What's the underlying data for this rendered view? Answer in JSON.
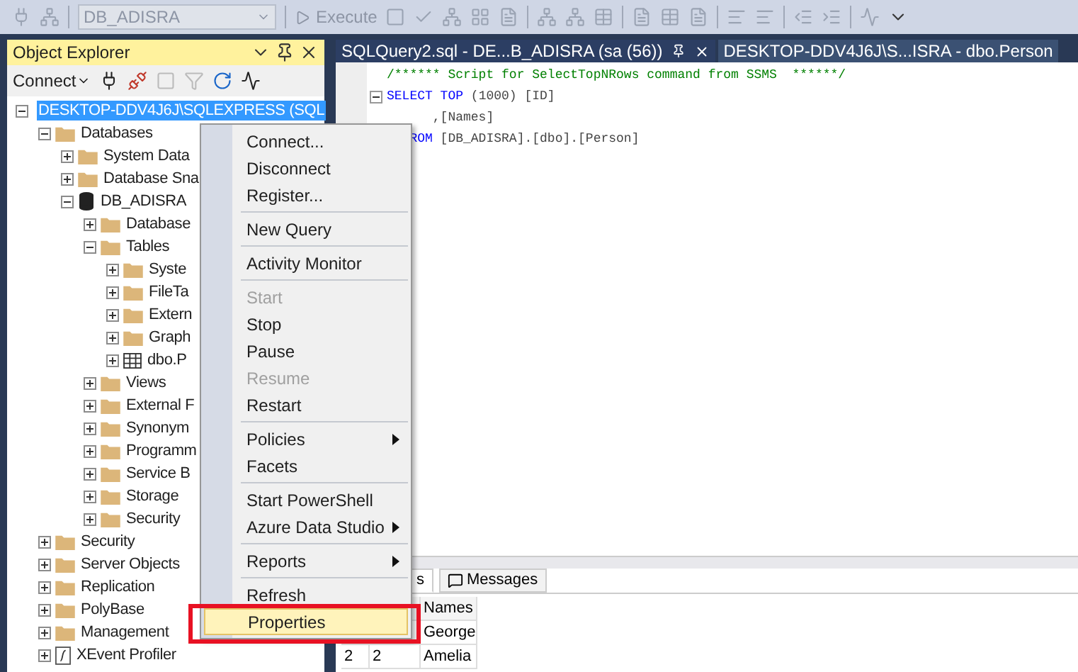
{
  "toolbar": {
    "database": "DB_ADISRA",
    "execute_label": "Execute"
  },
  "object_explorer": {
    "title": "Object Explorer",
    "connect_label": "Connect",
    "tree": [
      {
        "label": "DESKTOP-DDV4J6J\\SQLEXPRESS (SQL",
        "kind": "server",
        "expanded": true,
        "selected": true,
        "children": [
          {
            "label": "Databases",
            "kind": "folder",
            "expanded": true,
            "selected": false,
            "children": [
              {
                "label": "System Data",
                "kind": "folder",
                "expanded": false,
                "selected": false
              },
              {
                "label": "Database Sna",
                "kind": "folder",
                "expanded": false,
                "selected": false
              },
              {
                "label": "DB_ADISRA",
                "kind": "database",
                "expanded": true,
                "selected": false,
                "children": [
                  {
                    "label": "Database",
                    "kind": "folder",
                    "expanded": false,
                    "selected": false
                  },
                  {
                    "label": "Tables",
                    "kind": "folder",
                    "expanded": true,
                    "selected": false,
                    "children": [
                      {
                        "label": "Syste",
                        "kind": "folder",
                        "expanded": false,
                        "selected": false
                      },
                      {
                        "label": "FileTa",
                        "kind": "folder",
                        "expanded": false,
                        "selected": false
                      },
                      {
                        "label": "Extern",
                        "kind": "folder",
                        "expanded": false,
                        "selected": false
                      },
                      {
                        "label": "Graph",
                        "kind": "folder",
                        "expanded": false,
                        "selected": false
                      },
                      {
                        "label": "dbo.P",
                        "kind": "table",
                        "expanded": false,
                        "selected": false
                      }
                    ]
                  },
                  {
                    "label": "Views",
                    "kind": "folder",
                    "expanded": false,
                    "selected": false
                  },
                  {
                    "label": "External F",
                    "kind": "folder",
                    "expanded": false,
                    "selected": false
                  },
                  {
                    "label": "Synonym",
                    "kind": "folder",
                    "expanded": false,
                    "selected": false
                  },
                  {
                    "label": "Programm",
                    "kind": "folder",
                    "expanded": false,
                    "selected": false
                  },
                  {
                    "label": "Service B",
                    "kind": "folder",
                    "expanded": false,
                    "selected": false
                  },
                  {
                    "label": "Storage",
                    "kind": "folder",
                    "expanded": false,
                    "selected": false
                  },
                  {
                    "label": "Security",
                    "kind": "folder",
                    "expanded": false,
                    "selected": false
                  }
                ]
              }
            ]
          },
          {
            "label": "Security",
            "kind": "folder",
            "expanded": false,
            "selected": false
          },
          {
            "label": "Server Objects",
            "kind": "folder",
            "expanded": false,
            "selected": false
          },
          {
            "label": "Replication",
            "kind": "folder",
            "expanded": false,
            "selected": false
          },
          {
            "label": "PolyBase",
            "kind": "folder",
            "expanded": false,
            "selected": false
          },
          {
            "label": "Management",
            "kind": "folder",
            "expanded": false,
            "selected": false
          },
          {
            "label": "XEvent Profiler",
            "kind": "profiler",
            "expanded": false,
            "selected": false
          }
        ]
      }
    ]
  },
  "editor_tabs": [
    {
      "label": "SQLQuery2.sql - DE...B_ADISRA (sa (56))",
      "selected": true
    },
    {
      "label": "DESKTOP-DDV4J6J\\S...ISRA - dbo.Person",
      "selected": false
    }
  ],
  "code_lines": [
    [
      {
        "text": "/****** Script for SelectTopNRows command from SSMS  ******/",
        "kind": "comment"
      }
    ],
    [
      {
        "text": "SELECT TOP ",
        "kind": "keyword"
      },
      {
        "text": "(1000) [ID]",
        "kind": "plain"
      }
    ],
    [
      {
        "text": "      ,[Names]",
        "kind": "plain"
      }
    ],
    [
      {
        "text": "   ROM",
        "kind": "keyword"
      },
      {
        "text": " [DB_ADISRA].[dbo].[Person]",
        "kind": "plain"
      }
    ]
  ],
  "results": {
    "tabs": [
      {
        "label": "s",
        "selected": true
      },
      {
        "label": "Messages",
        "selected": false
      }
    ],
    "columns": [
      "Names"
    ],
    "rows": [
      {
        "names": "George"
      },
      {
        "row_number": "2",
        "column_2": "2",
        "names": "Amelia"
      }
    ]
  },
  "context_menu": [
    {
      "label": "Connect...",
      "kind": "item",
      "disabled": false,
      "submenu": false,
      "selected": false
    },
    {
      "label": "Disconnect",
      "kind": "item",
      "disabled": false,
      "submenu": false,
      "selected": false
    },
    {
      "label": "Register...",
      "kind": "item",
      "disabled": false,
      "submenu": false,
      "selected": false
    },
    {
      "kind": "separator"
    },
    {
      "label": "New Query",
      "kind": "item",
      "disabled": false,
      "submenu": false,
      "selected": false
    },
    {
      "kind": "separator"
    },
    {
      "label": "Activity Monitor",
      "kind": "item",
      "disabled": false,
      "submenu": false,
      "selected": false
    },
    {
      "kind": "separator"
    },
    {
      "label": "Start",
      "kind": "item",
      "disabled": true,
      "submenu": false,
      "selected": false
    },
    {
      "label": "Stop",
      "kind": "item",
      "disabled": false,
      "submenu": false,
      "selected": false
    },
    {
      "label": "Pause",
      "kind": "item",
      "disabled": false,
      "submenu": false,
      "selected": false
    },
    {
      "label": "Resume",
      "kind": "item",
      "disabled": true,
      "submenu": false,
      "selected": false
    },
    {
      "label": "Restart",
      "kind": "item",
      "disabled": false,
      "submenu": false,
      "selected": false
    },
    {
      "kind": "separator"
    },
    {
      "label": "Policies",
      "kind": "item",
      "disabled": false,
      "submenu": true,
      "selected": false
    },
    {
      "label": "Facets",
      "kind": "item",
      "disabled": false,
      "submenu": false,
      "selected": false
    },
    {
      "kind": "separator"
    },
    {
      "label": "Start PowerShell",
      "kind": "item",
      "disabled": false,
      "submenu": false,
      "selected": false
    },
    {
      "label": "Azure Data Studio",
      "kind": "item",
      "disabled": false,
      "submenu": true,
      "selected": false
    },
    {
      "kind": "separator"
    },
    {
      "label": "Reports",
      "kind": "item",
      "disabled": false,
      "submenu": true,
      "selected": false
    },
    {
      "kind": "separator"
    },
    {
      "label": "Refresh",
      "kind": "item",
      "disabled": false,
      "submenu": false,
      "selected": false
    },
    {
      "label": "Properties",
      "kind": "item",
      "disabled": false,
      "submenu": false,
      "selected": true
    }
  ]
}
